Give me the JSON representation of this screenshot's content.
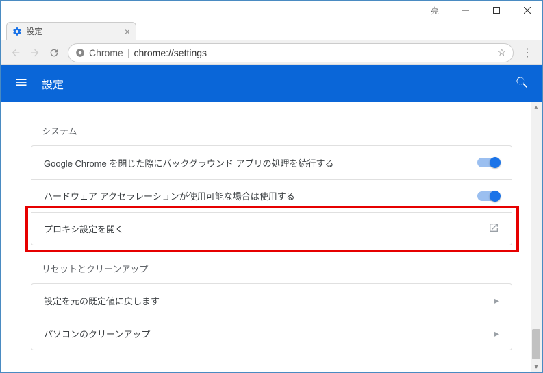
{
  "window": {
    "ime": "亮"
  },
  "tab": {
    "title": "設定"
  },
  "addressbar": {
    "origin": "Chrome",
    "url": "chrome://settings"
  },
  "header": {
    "title": "設定"
  },
  "sections": {
    "system": {
      "title": "システム",
      "rows": {
        "bg_apps": "Google Chrome を閉じた際にバックグラウンド アプリの処理を続行する",
        "hw_accel": "ハードウェア アクセラレーションが使用可能な場合は使用する",
        "proxy": "プロキシ設定を開く"
      }
    },
    "reset": {
      "title": "リセットとクリーンアップ",
      "rows": {
        "restore": "設定を元の既定値に戻します",
        "cleanup": "パソコンのクリーンアップ"
      }
    }
  }
}
